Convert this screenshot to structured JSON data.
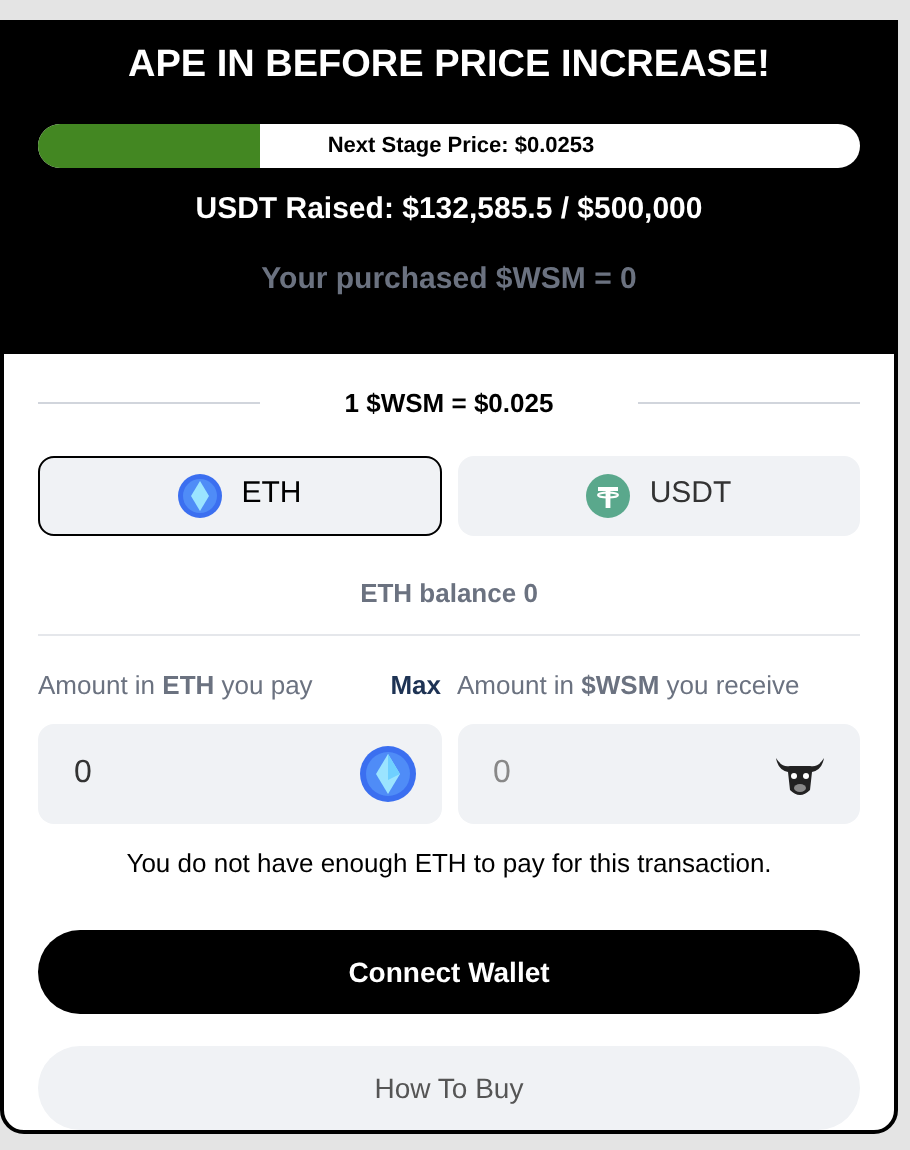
{
  "header": {
    "title": "APE IN BEFORE PRICE INCREASE!",
    "progress": {
      "level": 0.27,
      "label": "Next Stage Price: $0.0253"
    },
    "raised": "USDT Raised: $132,585.5 / $500,000",
    "purchased": "Your purchased $WSM = 0"
  },
  "rate": "1 $WSM = $0.025",
  "tabs": [
    {
      "label": "ETH",
      "kind": "eth",
      "selected": true
    },
    {
      "label": "USDT",
      "kind": "usdt",
      "selected": false
    }
  ],
  "balance": "ETH balance 0",
  "pay": {
    "label": "Amount in **ETH** you pay",
    "max": "Max",
    "value": "0"
  },
  "receive": {
    "label": "Amount in **$WSM** you receive",
    "value": "0"
  },
  "warning": "You do not have enough ETH to pay for this transaction.",
  "buttons": [
    {
      "label": "Connect Wallet",
      "kind": "primary"
    },
    {
      "label": "How To Buy",
      "kind": "secondary"
    }
  ]
}
